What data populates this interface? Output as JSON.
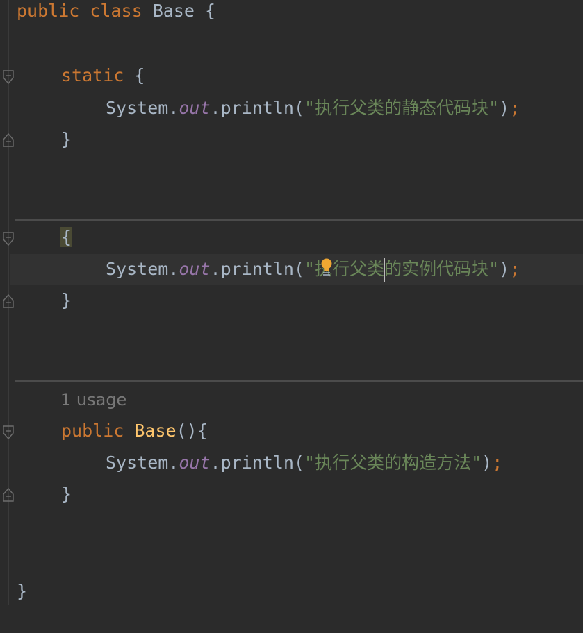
{
  "editor": {
    "lines": {
      "class_decl": {
        "kw1": "public",
        "kw2": "class",
        "name": "Base",
        "brace": "{"
      },
      "static_decl": {
        "kw": "static",
        "brace": "{"
      },
      "static_print": {
        "obj": "System",
        "dot1": ".",
        "field": "out",
        "dot2": ".",
        "method": "println",
        "open": "(",
        "str": "\"执行父类的静态代码块\"",
        "close": ")",
        "semi": ";"
      },
      "static_close": {
        "brace": "}"
      },
      "instance_open": {
        "brace": "{"
      },
      "instance_print": {
        "obj": "System",
        "dot1": ".",
        "field": "out",
        "dot2": ".",
        "method": "println",
        "open": "(",
        "str_q": "\"",
        "str": "执行父类的实例代码块",
        "str_end": "\"",
        "close": ")",
        "semi": ";"
      },
      "instance_close": {
        "brace": "}"
      },
      "usage_hint": "1 usage",
      "ctor_decl": {
        "kw": "public",
        "name": "Base",
        "parens": "()",
        "brace": "{"
      },
      "ctor_print": {
        "obj": "System",
        "dot1": ".",
        "field": "out",
        "dot2": ".",
        "method": "println",
        "open": "(",
        "str": "\"执行父类的构造方法\"",
        "close": ")",
        "semi": ";"
      },
      "ctor_close": {
        "brace": "}"
      },
      "class_close": {
        "brace": "}"
      }
    }
  },
  "icons": {
    "fold": "fold-marker-icon",
    "intention": "lightbulb-icon"
  },
  "colors": {
    "background": "#2b2b2b",
    "keyword": "#cc7832",
    "string": "#6a8759",
    "field": "#9876aa",
    "method_decl": "#ffc66d",
    "plain": "#a9b7c6"
  }
}
